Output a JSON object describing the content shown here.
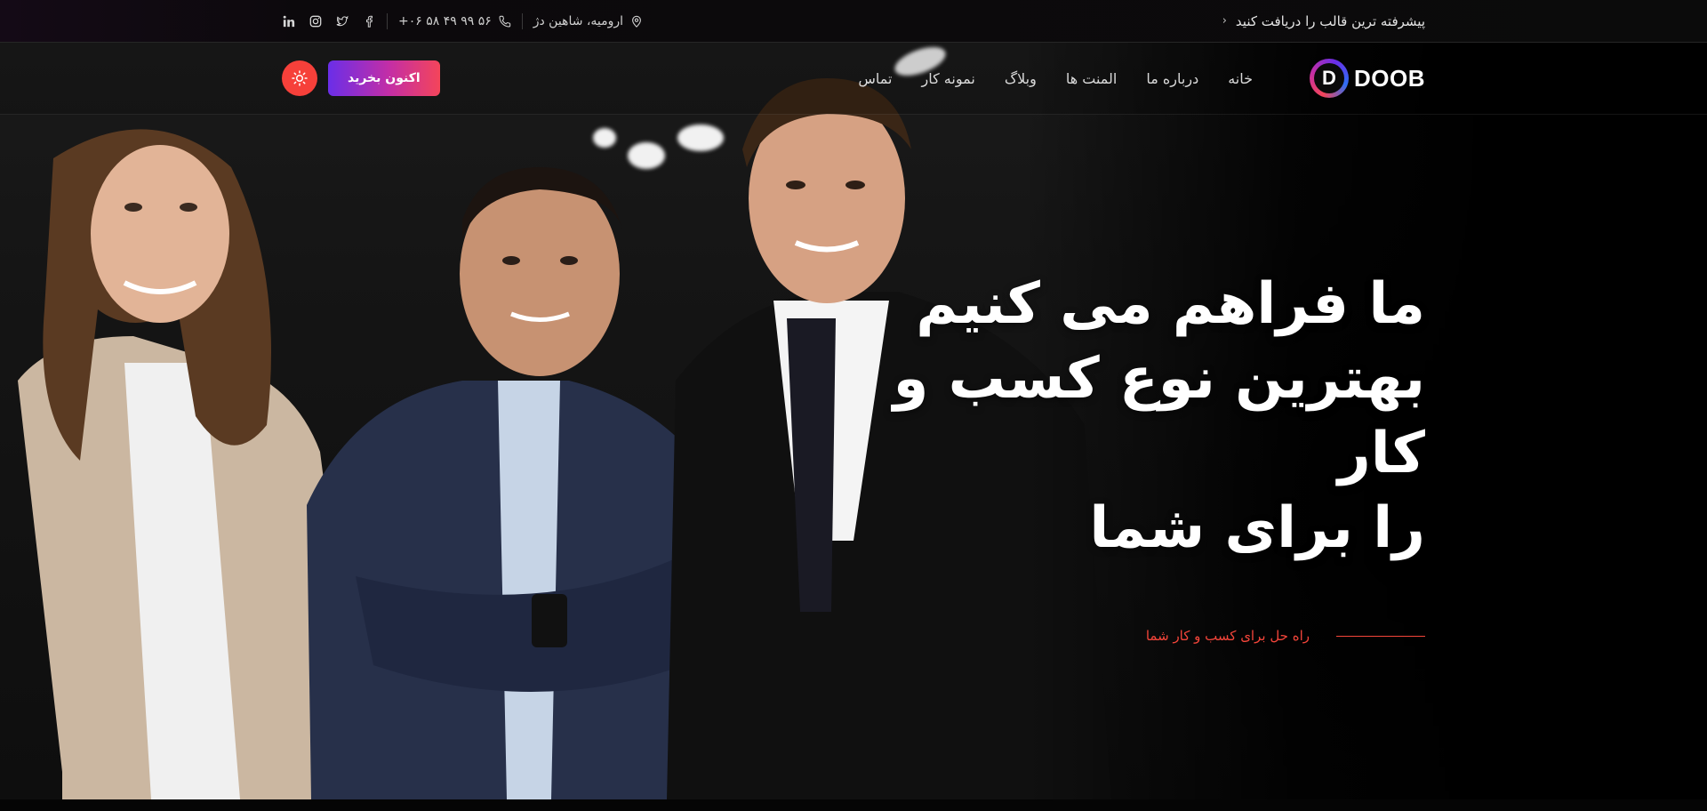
{
  "topbar": {
    "promo_text": "پیشرفته ترین قالب را دریافت کنید",
    "location": "ارومیه، شاهین دژ",
    "phone": "+۰۶ ۵۸ ۴۹ ۹۹ ۵۶",
    "socials": [
      "facebook-icon",
      "twitter-icon",
      "instagram-icon",
      "linkedin-icon"
    ]
  },
  "header": {
    "logo_letter": "D",
    "logo_text": "DOOB",
    "nav": [
      "خانه",
      "درباره ما",
      "المنت ها",
      "وبلاگ",
      "نمونه کار",
      "تماس"
    ],
    "buy_label": "اکنون بخرید"
  },
  "hero": {
    "title_lines": [
      "ما فراهم می کنیم",
      "بهترین نوع کسب و",
      "کار",
      "را برای شما"
    ],
    "subtitle": "راه حل برای کسب و کار شما"
  },
  "colors": {
    "accent": "#f6403a",
    "gradient_start": "#6a2ee8",
    "gradient_end": "#f4455a",
    "background": "#000000"
  }
}
